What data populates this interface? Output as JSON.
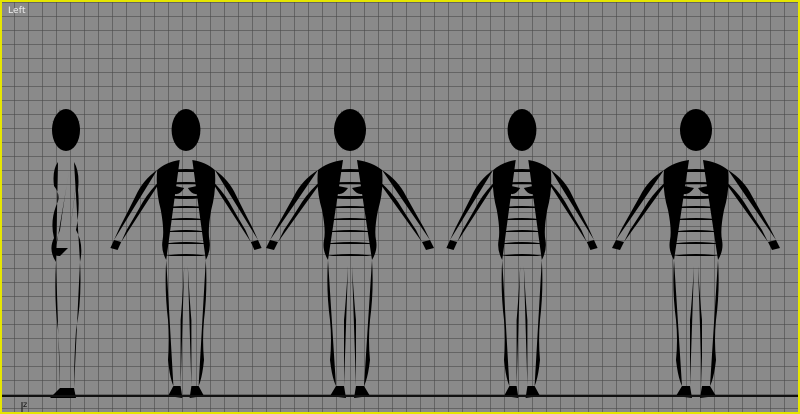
{
  "viewport": {
    "label": "Left",
    "axis_label": "z",
    "border_color": "#e6e600",
    "background_color": "#8a8a8a",
    "wire_color": "#1c3ea8"
  },
  "figures": [
    {
      "name": "side-view"
    },
    {
      "name": "three-quarter-front-view"
    },
    {
      "name": "front-view"
    },
    {
      "name": "three-quarter-back-view"
    },
    {
      "name": "back-view"
    }
  ]
}
